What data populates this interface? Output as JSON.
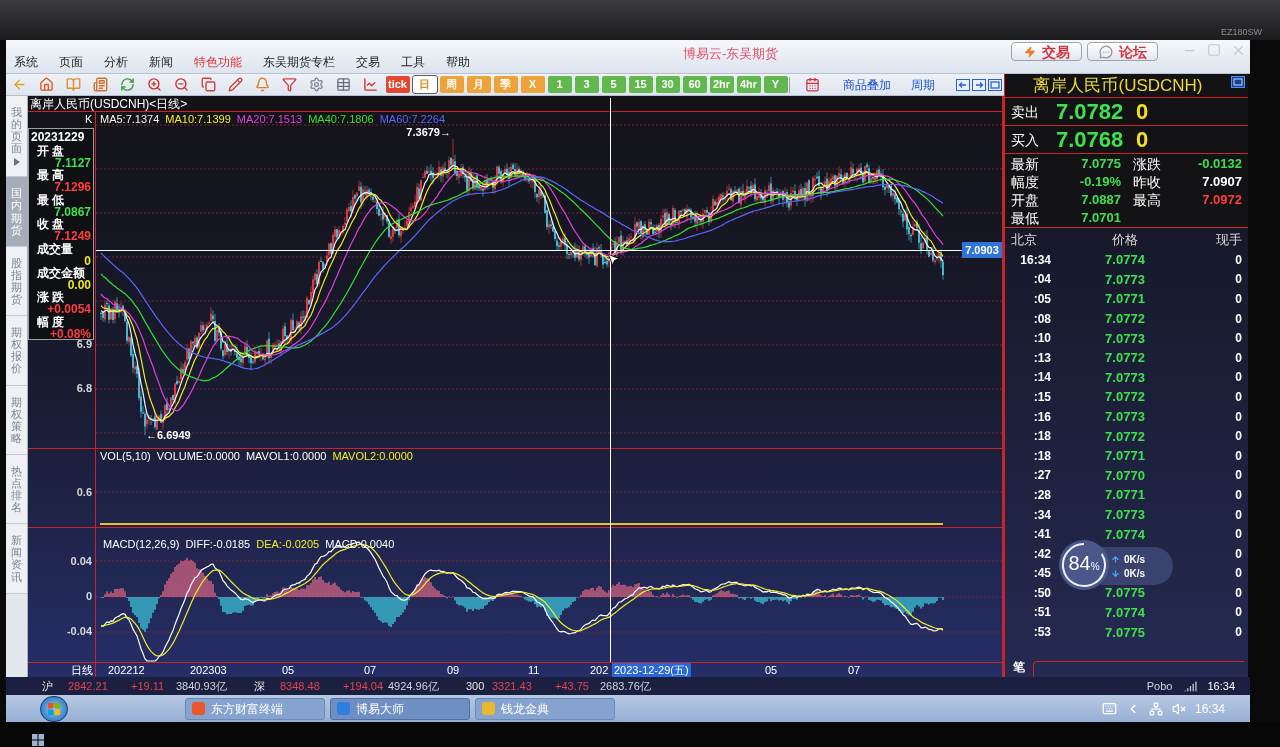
{
  "bezel": {
    "model_label": "EZ180SW"
  },
  "window": {
    "title": "博易云-东吴期货",
    "menu": [
      {
        "label": "系统",
        "featured": false
      },
      {
        "label": "页面",
        "featured": false
      },
      {
        "label": "分析",
        "featured": false
      },
      {
        "label": "新闻",
        "featured": false
      },
      {
        "label": "特色功能",
        "featured": true
      },
      {
        "label": "东吴期货专栏",
        "featured": false
      },
      {
        "label": "交易",
        "featured": false
      },
      {
        "label": "工具",
        "featured": false
      },
      {
        "label": "帮助",
        "featured": false
      }
    ],
    "header_buttons": [
      {
        "kind": "trade",
        "label": "交易"
      },
      {
        "kind": "forum",
        "label": "论坛"
      }
    ]
  },
  "toolbar": {
    "periods": [
      {
        "label": "tick",
        "kind": "tick",
        "selected": false
      },
      {
        "label": "日",
        "kind": "span",
        "selected": true
      },
      {
        "label": "周",
        "kind": "span",
        "selected": false
      },
      {
        "label": "月",
        "kind": "span",
        "selected": false
      },
      {
        "label": "季",
        "kind": "span",
        "selected": false
      },
      {
        "label": "X",
        "kind": "span",
        "selected": false
      },
      {
        "label": "1",
        "kind": "minutes",
        "selected": false
      },
      {
        "label": "3",
        "kind": "minutes",
        "selected": false
      },
      {
        "label": "5",
        "kind": "minutes",
        "selected": false
      },
      {
        "label": "15",
        "kind": "minutes",
        "selected": false
      },
      {
        "label": "30",
        "kind": "minutes",
        "selected": false
      },
      {
        "label": "60",
        "kind": "minutes",
        "selected": false
      },
      {
        "label": "2hr",
        "kind": "minutes",
        "selected": false
      },
      {
        "label": "4hr",
        "kind": "minutes",
        "selected": false
      },
      {
        "label": "Y",
        "kind": "minutes",
        "selected": false
      }
    ],
    "links": [
      {
        "label": "商品叠加"
      },
      {
        "label": "周期"
      }
    ]
  },
  "side_tabs": [
    {
      "label": "我的页面",
      "selected": false,
      "has_menu": true
    },
    {
      "label": "国内期货",
      "selected": true,
      "has_menu": false
    },
    {
      "label": "股指期货",
      "selected": false,
      "has_menu": false
    },
    {
      "label": "期权报价",
      "selected": false,
      "has_menu": false
    },
    {
      "label": "期权策略",
      "selected": false,
      "has_menu": false
    },
    {
      "label": "热点排名",
      "selected": false,
      "has_menu": false
    },
    {
      "label": "新闻资讯",
      "selected": false,
      "has_menu": false
    }
  ],
  "chart": {
    "title": "离岸人民币(USDCNH)<日线>",
    "series_label": "K",
    "legend": [
      {
        "label": "MA5:7.1374",
        "color": "#f2f2f2"
      },
      {
        "label": "MA10:7.1399",
        "color": "#f0ec26"
      },
      {
        "label": "MA20:7.1513",
        "color": "#e03fe0"
      },
      {
        "label": "MA40:7.1806",
        "color": "#33e033"
      },
      {
        "label": "MA60:7.2264",
        "color": "#5a66ff"
      }
    ],
    "price_axis": [
      "6.9",
      "6.8"
    ],
    "high_marker": "7.3679→",
    "low_marker": "←6.6949",
    "crosshair": {
      "price": "7.0903",
      "date": "2023-12-29(五)"
    },
    "info_box": {
      "date": "20231229",
      "fields": [
        {
          "label": "开 盘",
          "value": "7.1127",
          "color": "#3fe04e"
        },
        {
          "label": "最 高",
          "value": "7.1296",
          "color": "#ff3d3d"
        },
        {
          "label": "最 低",
          "value": "7.0867",
          "color": "#3fe04e"
        },
        {
          "label": "收 盘",
          "value": "7.1249",
          "color": "#ff3d3d"
        },
        {
          "label": "成交量",
          "value": "0",
          "color": "#f2e41c"
        },
        {
          "label": "成交金额",
          "value": "0.00",
          "color": "#f2e41c"
        },
        {
          "label": "涨 跌",
          "value": "+0.0054",
          "color": "#ff3d3d"
        },
        {
          "label": "幅 度",
          "value": "+0.08%",
          "color": "#ff3d3d"
        }
      ]
    }
  },
  "volume_panel": {
    "legend": [
      {
        "label": "VOL(5,10)",
        "color": "#ffffff"
      },
      {
        "label": "VOLUME:0.0000",
        "color": "#ffffff"
      },
      {
        "label": "MAVOL1:0.0000",
        "color": "#ffffff"
      },
      {
        "label": "MAVOL2:0.0000",
        "color": "#f0ec26"
      }
    ],
    "axis": [
      "0.6"
    ]
  },
  "macd_panel": {
    "legend": [
      {
        "label": "MACD(12,26,9)",
        "color": "#ffffff"
      },
      {
        "label": "DIFF:-0.0185",
        "color": "#ffffff"
      },
      {
        "label": "DEA:-0.0205",
        "color": "#f0ec26"
      },
      {
        "label": "MACD:0.0040",
        "color": "#ffffff"
      }
    ],
    "axis": [
      "0.04",
      "0",
      "-0.04"
    ]
  },
  "x_axis": {
    "period": "日线",
    "labels": [
      "202212",
      "202303",
      "05",
      "07",
      "09",
      "11",
      "202",
      "05",
      "07"
    ]
  },
  "quote_panel": {
    "title": "离岸人民币(USDCNH)",
    "book": [
      {
        "label": "卖出",
        "price": "7.0782",
        "size": "0"
      },
      {
        "label": "买入",
        "price": "7.0768",
        "size": "0"
      }
    ],
    "stats": [
      {
        "label": "最新",
        "value": "7.0775",
        "color": "#3fe04e"
      },
      {
        "label": "涨跌",
        "value": "-0.0132",
        "color": "#3fe04e"
      },
      {
        "label": "幅度",
        "value": "-0.19%",
        "color": "#3fe04e"
      },
      {
        "label": "昨收",
        "value": "7.0907",
        "color": "#ffffff"
      },
      {
        "label": "开盘",
        "value": "7.0887",
        "color": "#3fe04e"
      },
      {
        "label": "最高",
        "value": "7.0972",
        "color": "#ff3d3d"
      },
      {
        "label": "最低",
        "value": "7.0701",
        "color": "#3fe04e"
      }
    ],
    "ticks_header": [
      "北京",
      "价格",
      "现手"
    ],
    "ticks": [
      {
        "time": "16:34",
        "price": "7.0774",
        "volume": "0"
      },
      {
        "time": ":04",
        "price": "7.0773",
        "volume": "0"
      },
      {
        "time": ":05",
        "price": "7.0771",
        "volume": "0"
      },
      {
        "time": ":08",
        "price": "7.0772",
        "volume": "0"
      },
      {
        "time": ":10",
        "price": "7.0773",
        "volume": "0"
      },
      {
        "time": ":13",
        "price": "7.0772",
        "volume": "0"
      },
      {
        "time": ":14",
        "price": "7.0773",
        "volume": "0"
      },
      {
        "time": ":15",
        "price": "7.0772",
        "volume": "0"
      },
      {
        "time": ":16",
        "price": "7.0773",
        "volume": "0"
      },
      {
        "time": ":18",
        "price": "7.0772",
        "volume": "0"
      },
      {
        "time": ":18",
        "price": "7.0771",
        "volume": "0"
      },
      {
        "time": ":27",
        "price": "7.0770",
        "volume": "0"
      },
      {
        "time": ":28",
        "price": "7.0771",
        "volume": "0"
      },
      {
        "time": ":34",
        "price": "7.0773",
        "volume": "0"
      },
      {
        "time": ":41",
        "price": "7.0774",
        "volume": "0"
      },
      {
        "time": ":42",
        "volume": "0"
      },
      {
        "time": ":45",
        "volume": "0"
      },
      {
        "time": ":50",
        "price": "7.0775",
        "volume": "0"
      },
      {
        "time": ":51",
        "price": "7.0774",
        "volume": "0"
      },
      {
        "time": ":53",
        "price": "7.0775",
        "volume": "0"
      }
    ],
    "footer_tab": "笔"
  },
  "net_widget": {
    "percent": "84",
    "unit": "%",
    "upload": "0K/s",
    "download": "0K/s"
  },
  "status_bar": {
    "indices": [
      {
        "name": "沪",
        "value": "2842.21",
        "change": "+19.11",
        "turnover": "3840.93亿",
        "color": "#e5414f"
      },
      {
        "name": "深",
        "value": "8348.48",
        "change": "+194.04",
        "turnover": "4924.96亿",
        "color": "#e5414f"
      },
      {
        "name": "300",
        "value": "3321.43",
        "change": "+43.75",
        "turnover": "2683.76亿",
        "color": "#e5414f"
      }
    ],
    "brand": "Pobo",
    "time": "16:34"
  },
  "taskbar": {
    "apps": [
      {
        "label": "东方财富终端",
        "selected": false,
        "color": "#e8562a"
      },
      {
        "label": "博易大师",
        "selected": true,
        "color": "#2f7fe0"
      },
      {
        "label": "钱龙金典",
        "selected": false,
        "color": "#e8b830"
      }
    ],
    "clock": "16:34"
  }
}
